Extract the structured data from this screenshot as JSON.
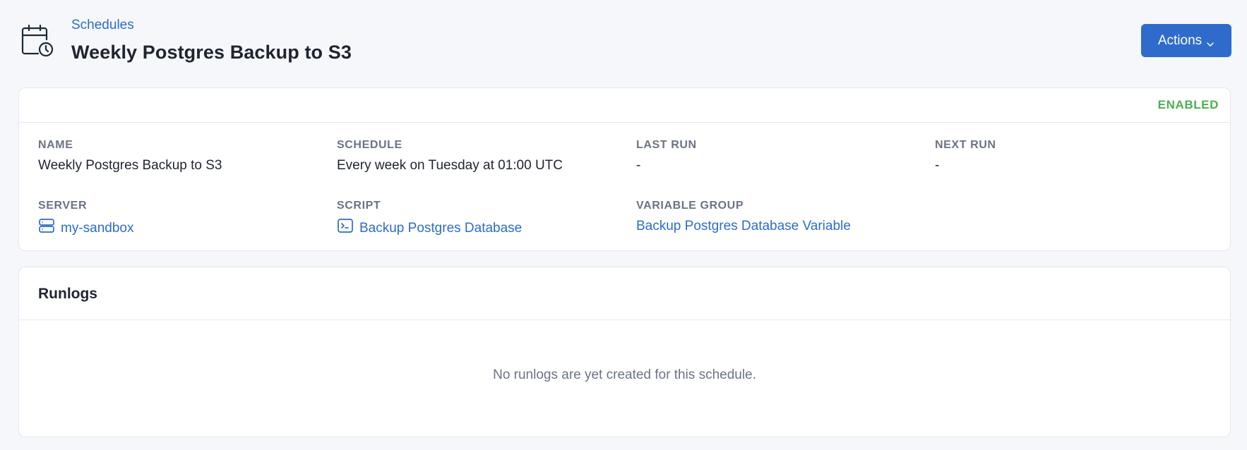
{
  "header": {
    "icon": "calendar-clock-icon",
    "breadcrumb": "Schedules",
    "title": "Weekly Postgres Backup to S3",
    "actions_label": "Actions",
    "actions_icon": "chevron-down-icon"
  },
  "details": {
    "status": "ENABLED",
    "status_color": "#4caf50",
    "fields": {
      "name": {
        "label": "NAME",
        "value": "Weekly Postgres Backup to S3"
      },
      "schedule": {
        "label": "SCHEDULE",
        "value": "Every week on Tuesday at 01:00 UTC"
      },
      "last_run": {
        "label": "LAST RUN",
        "value": "-"
      },
      "next_run": {
        "label": "NEXT RUN",
        "value": "-"
      },
      "server": {
        "label": "SERVER",
        "value": "my-sandbox",
        "icon": "server-icon"
      },
      "script": {
        "label": "SCRIPT",
        "value": "Backup Postgres Database",
        "icon": "terminal-icon"
      },
      "variable_group": {
        "label": "VARIABLE GROUP",
        "value": "Backup Postgres Database Variable"
      }
    }
  },
  "runlogs": {
    "title": "Runlogs",
    "empty_message": "No runlogs are yet created for this schedule."
  },
  "colors": {
    "accent": "#2f6bcb",
    "link": "#2d6cc9",
    "background": "#f5f7fb"
  }
}
